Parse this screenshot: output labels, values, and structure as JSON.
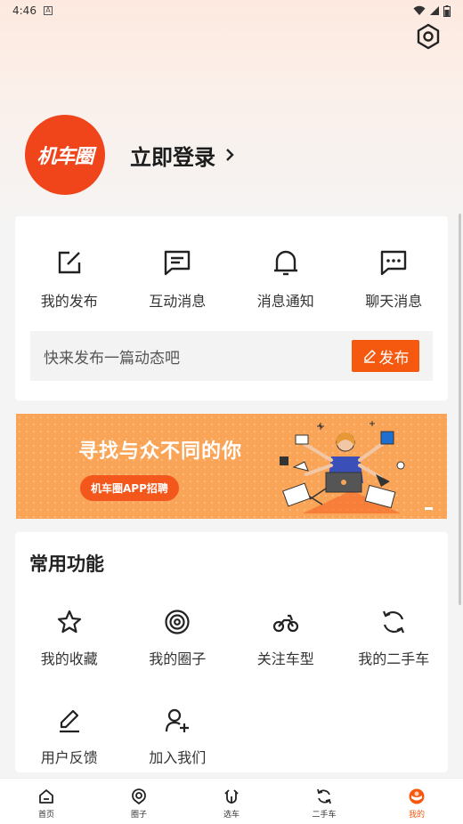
{
  "status": {
    "time": "4:46",
    "notif_glyph": "A"
  },
  "profile": {
    "logo_text": "机车圈",
    "login_label": "立即登录"
  },
  "quick_actions": [
    {
      "label": "我的发布",
      "icon": "edit-square-icon"
    },
    {
      "label": "互动消息",
      "icon": "message-lines-icon"
    },
    {
      "label": "消息通知",
      "icon": "bell-icon"
    },
    {
      "label": "聊天消息",
      "icon": "chat-dots-icon"
    }
  ],
  "post": {
    "placeholder": "快来发布一篇动态吧",
    "button_label": "发布"
  },
  "banner": {
    "title": "寻找与众不同的你",
    "pill": "机车圈APP招聘"
  },
  "common": {
    "title": "常用功能",
    "items": [
      {
        "label": "我的收藏",
        "icon": "star-icon"
      },
      {
        "label": "我的圈子",
        "icon": "circle-target-icon"
      },
      {
        "label": "关注车型",
        "icon": "motorcycle-icon"
      },
      {
        "label": "我的二手车",
        "icon": "refresh-icon"
      },
      {
        "label": "用户反馈",
        "icon": "pencil-icon"
      },
      {
        "label": "加入我们",
        "icon": "add-user-icon"
      }
    ]
  },
  "tabs": [
    {
      "label": "首页",
      "icon": "home-icon",
      "active": false
    },
    {
      "label": "圈子",
      "icon": "circle-icon",
      "active": false
    },
    {
      "label": "选车",
      "icon": "choose-car-icon",
      "active": false
    },
    {
      "label": "二手车",
      "icon": "used-car-icon",
      "active": false
    },
    {
      "label": "我的",
      "icon": "profile-icon",
      "active": true
    }
  ],
  "colors": {
    "accent": "#f5580f",
    "logo_bg": "#f0441b",
    "banner_bg": "#f9a457"
  }
}
